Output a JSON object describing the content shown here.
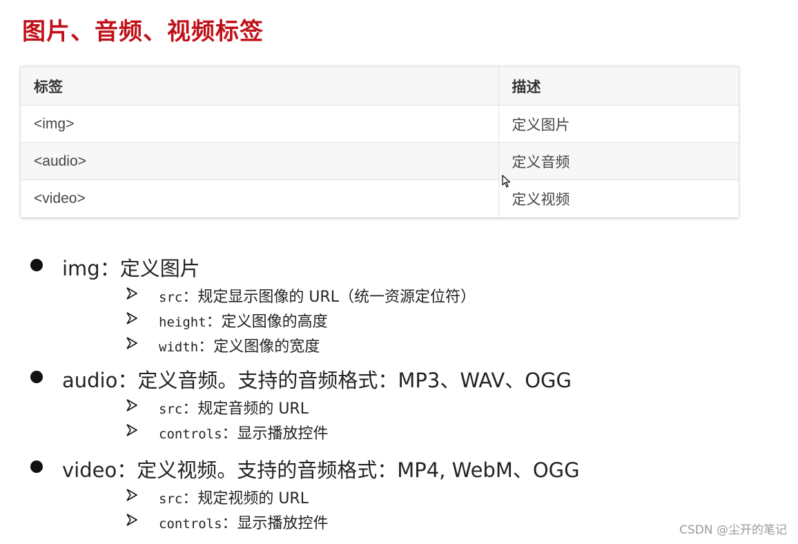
{
  "title": "图片、音频、视频标签",
  "table": {
    "headers": [
      "标签",
      "描述"
    ],
    "rows": [
      {
        "tag": "<img>",
        "desc": "定义图片"
      },
      {
        "tag": "<audio>",
        "desc": "定义音频"
      },
      {
        "tag": "<video>",
        "desc": "定义视频"
      }
    ]
  },
  "bullets": [
    {
      "text": "img：定义图片",
      "subs": [
        {
          "code": "src",
          "text": "：规定显示图像的 URL（统一资源定位符）"
        },
        {
          "code": "height",
          "text": "：定义图像的高度"
        },
        {
          "code": "width",
          "text": "：定义图像的宽度"
        }
      ]
    },
    {
      "text": "audio：定义音频。支持的音频格式：MP3、WAV、OGG",
      "subs": [
        {
          "code": "src",
          "text": "：规定音频的 URL"
        },
        {
          "code": "controls",
          "text": "：显示播放控件"
        }
      ]
    },
    {
      "text": "video：定义视频。支持的音频格式：MP4, WebM、OGG",
      "subs": [
        {
          "code": "src",
          "text": "：规定视频的 URL"
        },
        {
          "code": "controls",
          "text": "：显示播放控件"
        }
      ]
    }
  ],
  "watermark": "CSDN @尘开的笔记",
  "colors": {
    "title": "#c0111a",
    "table_header_bg": "#f7f7f7",
    "table_border": "#e1e1e1"
  },
  "icons": {
    "bullet": "filled-circle",
    "sub_bullet": "arrow-right-outline-icon",
    "cursor": "mouse-pointer-icon"
  }
}
